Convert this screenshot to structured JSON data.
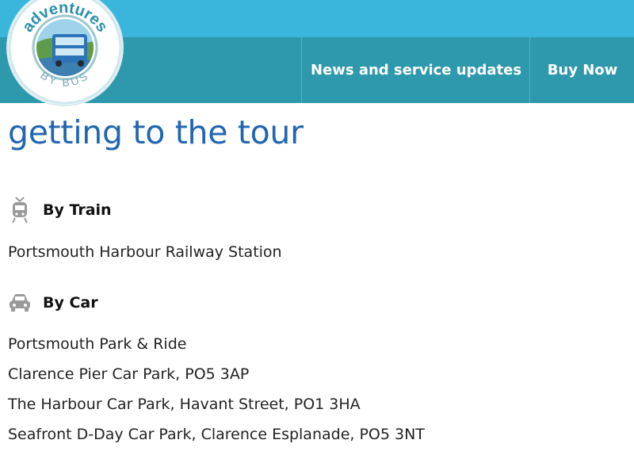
{
  "header": {
    "logo": {
      "alt": "adventures BY BUS",
      "text_top": "adventures",
      "text_bottom": "BY BUS"
    },
    "nav": [
      {
        "label": "News and service updates"
      },
      {
        "label": "Buy Now"
      }
    ],
    "colors": {
      "top_strip": "#3ab6dc",
      "nav_bar": "#2e99ac",
      "nav_text": "#ffffff"
    }
  },
  "main": {
    "title": "getting to the tour",
    "title_color": "#2166b1",
    "sections": [
      {
        "icon": "train-icon",
        "heading": "By Train",
        "lines": [
          "Portsmouth Harbour Railway Station"
        ]
      },
      {
        "icon": "car-icon",
        "heading": "By Car",
        "lines": [
          "Portsmouth Park & Ride",
          "Clarence Pier Car Park, PO5 3AP",
          "The Harbour Car Park, Havant Street, PO1 3HA",
          "Seafront D-Day Car Park, Clarence Esplanade, PO5 3NT"
        ]
      }
    ]
  }
}
